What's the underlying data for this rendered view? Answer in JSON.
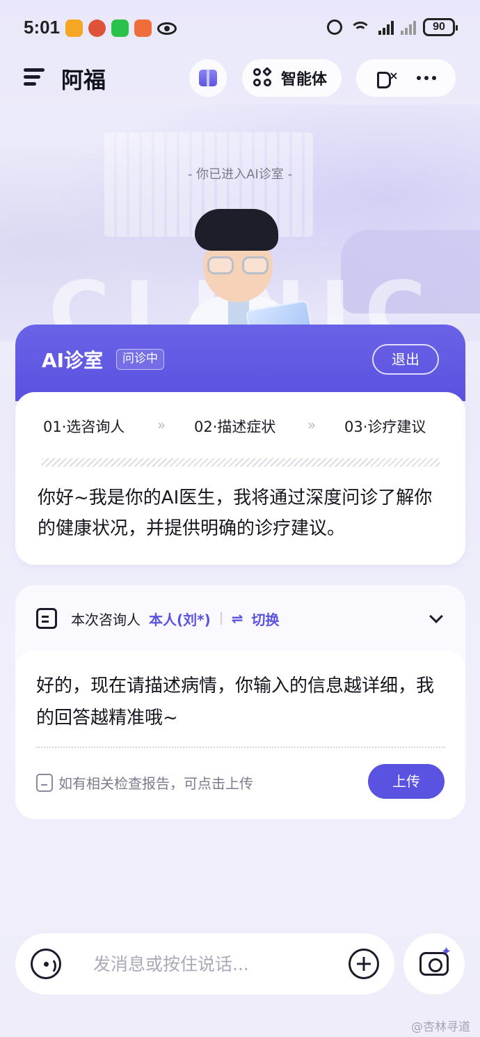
{
  "status_bar": {
    "time": "5:01",
    "battery": "90"
  },
  "header": {
    "title": "阿福",
    "agent_label": "智能体",
    "icons": [
      "menu-icon",
      "gift-icon",
      "agent-icon",
      "mute-icon",
      "more-icon"
    ]
  },
  "clinic": {
    "entered_tip": "-   你已进入AI诊室   -",
    "title": "AI诊室",
    "badge": "问诊中",
    "exit_label": "退出"
  },
  "steps": [
    {
      "label": "01·选咨询人"
    },
    {
      "label": "02·描述症状"
    },
    {
      "label": "03·诊疗建议"
    }
  ],
  "step_arrow": "»",
  "greeting": "你好~我是你的AI医生，我将通过深度问诊了解你的健康状况，并提供明确的诊疗建议。",
  "consult": {
    "label": "本次咨询人",
    "person": "本人(刘*)",
    "switch_icon": "⇌",
    "switch_label": "切换"
  },
  "reply": {
    "text": "好的，现在请描述病情，你输入的信息越详细，我的回答越精准哦~",
    "upload_hint": "如有相关检查报告，可点击上传",
    "upload_label": "上传"
  },
  "input": {
    "placeholder": "发消息或按住说话..."
  },
  "watermark": "@杏林寻道",
  "colors": {
    "accent": "#5a52e0",
    "background": "#eceafa"
  }
}
